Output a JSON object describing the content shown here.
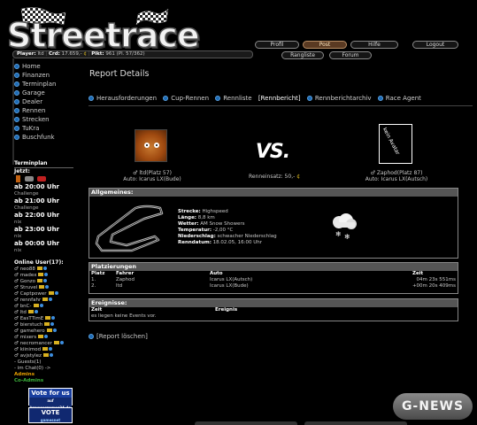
{
  "brand": {
    "title": "Streetrace"
  },
  "nav_top": [
    {
      "label": "Profil"
    },
    {
      "label": "Post"
    },
    {
      "label": "Hilfe"
    },
    {
      "label": "Logout"
    }
  ],
  "nav_bottom": [
    {
      "label": "Rangliste"
    },
    {
      "label": "Forum"
    }
  ],
  "status": {
    "player_label": "Player:",
    "player_value": "ltd",
    "crd_label": "Crd:",
    "crd_value": "17.659,-",
    "plkt_label": "Plkt:",
    "plkt_value": "961 (Pl. 57/362)"
  },
  "sidebar": {
    "items": [
      {
        "label": "Home"
      },
      {
        "label": "Finanzen"
      },
      {
        "label": "Terminplan"
      },
      {
        "label": "Garage"
      },
      {
        "label": "Dealer"
      },
      {
        "label": "Rennen"
      },
      {
        "label": "Strecken"
      },
      {
        "label": "TuKra"
      },
      {
        "label": "Buschfunk"
      }
    ],
    "terminplan": {
      "title": "Terminplan",
      "now_label": "Jetzt:",
      "slots": [
        {
          "time": "ab 20:00 Uhr",
          "type": "Challenge"
        },
        {
          "time": "ab 21:00 Uhr",
          "type": "Challenge"
        },
        {
          "time": "ab 22:00 Uhr",
          "type": "nix"
        },
        {
          "time": "ab 23:00 Uhr",
          "type": "nix"
        },
        {
          "time": "ab 00:00 Uhr",
          "type": "nix"
        }
      ]
    },
    "online": {
      "title": "Online User(17):",
      "users": [
        "neo88",
        "madex",
        "Gonzo",
        "Struvel",
        "Captpower",
        "rennfahr",
        "bnC-",
        "ltd",
        "EasTTimE",
        "bierstuch",
        "gamehero",
        "mixers",
        "necromancer",
        "kiinimod",
        "avjstylez"
      ],
      "guests": "- Guests(1)",
      "chat": "- im Chat(0) ->",
      "admins": "Admins",
      "coadmins": "Co-Admins"
    },
    "banners": {
      "vote_title": "Vote for us",
      "vote_sub": "auf browsergames24.de",
      "vote2_title": "VOTE",
      "vote2_sub": "gamesnet"
    }
  },
  "page": {
    "title": "Report Details",
    "subnav": [
      {
        "label": "Herausforderungen",
        "bullet": true
      },
      {
        "label": "Cup-Rennen",
        "bullet": true
      },
      {
        "label": "Rennliste",
        "bullet": true
      },
      {
        "label": "[Rennbericht]",
        "bullet": false
      },
      {
        "label": "Rennberichtarchiv",
        "bullet": true
      },
      {
        "label": "Race Agent",
        "bullet": true
      }
    ],
    "left_driver": {
      "name": "ltd(Platz 57)",
      "auto": "Auto: Icarus LX(Bude)"
    },
    "vs": "VS.",
    "einsatz_label": "Renneinsatz: 50,-",
    "right_driver": {
      "name": "Zaphod(Platz 87)",
      "auto": "Auto: Icarus LX(Autsch)",
      "avatar_text": "kein Avatar"
    },
    "allgemeines": {
      "title": "Allgemeines:",
      "rows": [
        {
          "k": "Strecke:",
          "v": "Highspeed"
        },
        {
          "k": "Länge:",
          "v": "8,8 km"
        },
        {
          "k": "Wetter:",
          "v": "AM Snow Showers"
        },
        {
          "k": "Temperatur:",
          "v": "-2,00 °C"
        },
        {
          "k": "Niederschlag:",
          "v": "schwacher Niederschlag"
        },
        {
          "k": "Renndatum:",
          "v": "18.02.05, 16:00 Uhr"
        }
      ]
    },
    "platzierungen": {
      "title": "Platzierungen",
      "headers": [
        "Platz",
        "Fahrer",
        "Auto",
        "Zeit"
      ],
      "rows": [
        {
          "platz": "1.",
          "fahrer": "Zaphod",
          "auto": "Icarus LX(Autsch)",
          "zeit": "04m 23s 551ms"
        },
        {
          "platz": "2.",
          "fahrer": "ltd",
          "auto": "Icarus LX(Bude)",
          "zeit": "+00m 20s 409ms"
        }
      ]
    },
    "ereignisse": {
      "title": "Ereignisse:",
      "headers": [
        "Zeit",
        "Ereignis"
      ],
      "empty": "es liegen keine Events vor."
    },
    "delete_label": "[Report löschen]"
  },
  "watermark": "G-NEWS",
  "colors": {
    "accent_blue": "#1d6bb5",
    "active_nav": "#5a3a22",
    "panel_header": "#555555",
    "coin": "#e6c020"
  }
}
